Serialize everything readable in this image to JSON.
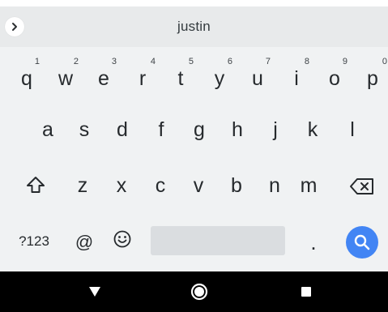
{
  "suggestion_bar": {
    "suggestion": "justin",
    "expand_icon": "chevron-right-icon"
  },
  "keyboard": {
    "row1": [
      {
        "letter": "q",
        "hint": "1"
      },
      {
        "letter": "w",
        "hint": "2"
      },
      {
        "letter": "e",
        "hint": "3"
      },
      {
        "letter": "r",
        "hint": "4"
      },
      {
        "letter": "t",
        "hint": "5"
      },
      {
        "letter": "y",
        "hint": "6"
      },
      {
        "letter": "u",
        "hint": "7"
      },
      {
        "letter": "i",
        "hint": "8"
      },
      {
        "letter": "o",
        "hint": "9"
      },
      {
        "letter": "p",
        "hint": "0"
      }
    ],
    "row2": [
      "a",
      "s",
      "d",
      "f",
      "g",
      "h",
      "j",
      "k",
      "l"
    ],
    "row3": [
      "z",
      "x",
      "c",
      "v",
      "b",
      "n",
      "m"
    ],
    "shift_icon": "shift-arrow-icon",
    "backspace_icon": "backspace-icon",
    "symbols_label": "?123",
    "at_label": "@",
    "emoji_icon": "smiley-icon",
    "period_label": ".",
    "search_icon": "search-icon",
    "accent_color": "#4285f4"
  },
  "nav_bar": {
    "back_icon": "triangle-back-icon",
    "home_icon": "circle-home-icon",
    "recents_icon": "square-recents-icon"
  }
}
